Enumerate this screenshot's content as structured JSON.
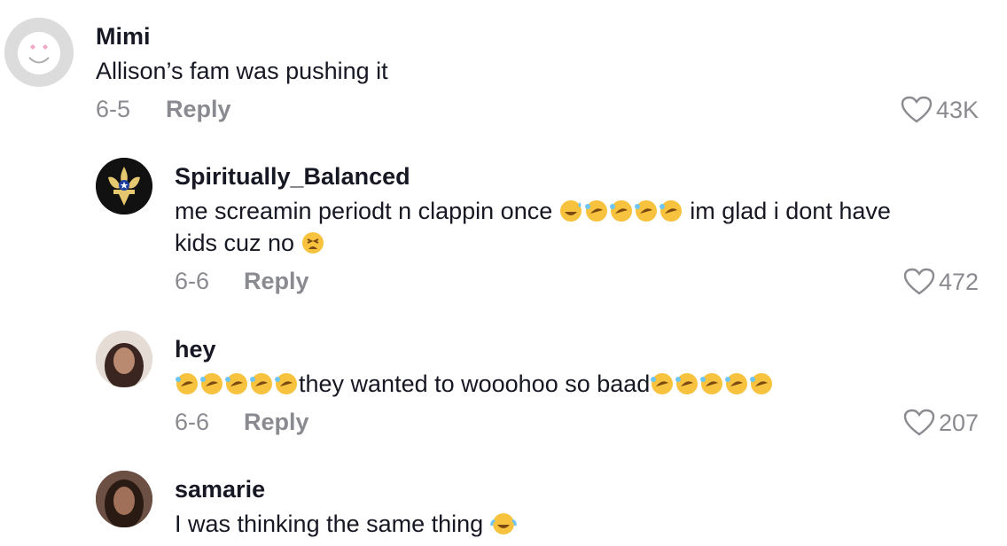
{
  "comments": [
    {
      "username": "Mimi",
      "text": "Allison’s fam was pushing it",
      "date": "6-5",
      "reply_label": "Reply",
      "likes": "43K",
      "avatar": "default-smiley-avatar"
    },
    {
      "username": "Spiritually_Balanced",
      "text_line1_a": "me screamin periodt n clappin once ",
      "text_line1_b": " im glad i dont have",
      "text_line2": "kids cuz no ",
      "date": "6-6",
      "reply_label": "Reply",
      "likes": "472",
      "avatar": "fleur-de-lis-logo-avatar"
    },
    {
      "username": "hey",
      "text_mid": "they wanted to wooohoo so baad",
      "date": "6-6",
      "reply_label": "Reply",
      "likes": "207",
      "avatar": "user-photo-avatar"
    },
    {
      "username": "samarie",
      "text": "I was thinking the same thing ",
      "avatar": "user-photo-avatar"
    }
  ],
  "colors": {
    "text": "#161823",
    "muted": "#8a8b91",
    "emoji_yellow": "#f7c23d"
  }
}
